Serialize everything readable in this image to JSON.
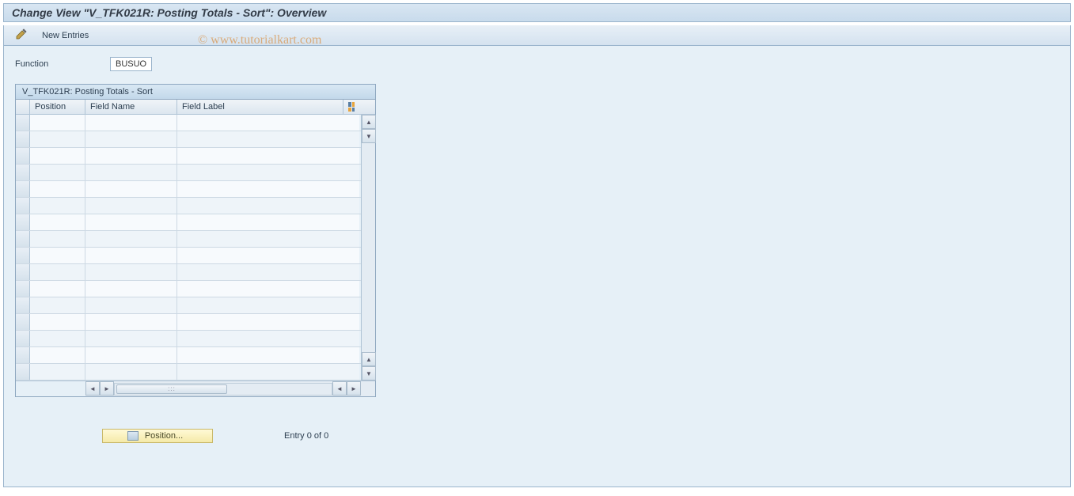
{
  "header": {
    "title": "Change View \"V_TFK021R: Posting Totals - Sort\": Overview"
  },
  "toolbar": {
    "new_entries_label": "New Entries"
  },
  "form": {
    "function_label": "Function",
    "function_value": "BUSUO"
  },
  "panel": {
    "title": "V_TFK021R: Posting Totals - Sort",
    "columns": {
      "position": "Position",
      "field_name": "Field Name",
      "field_label": "Field Label"
    },
    "rows": [
      {},
      {},
      {},
      {},
      {},
      {},
      {},
      {},
      {},
      {},
      {},
      {},
      {},
      {},
      {},
      {}
    ]
  },
  "footer": {
    "position_button_label": "Position...",
    "entry_text": "Entry 0 of 0"
  },
  "watermark": "© www.tutorialkart.com"
}
